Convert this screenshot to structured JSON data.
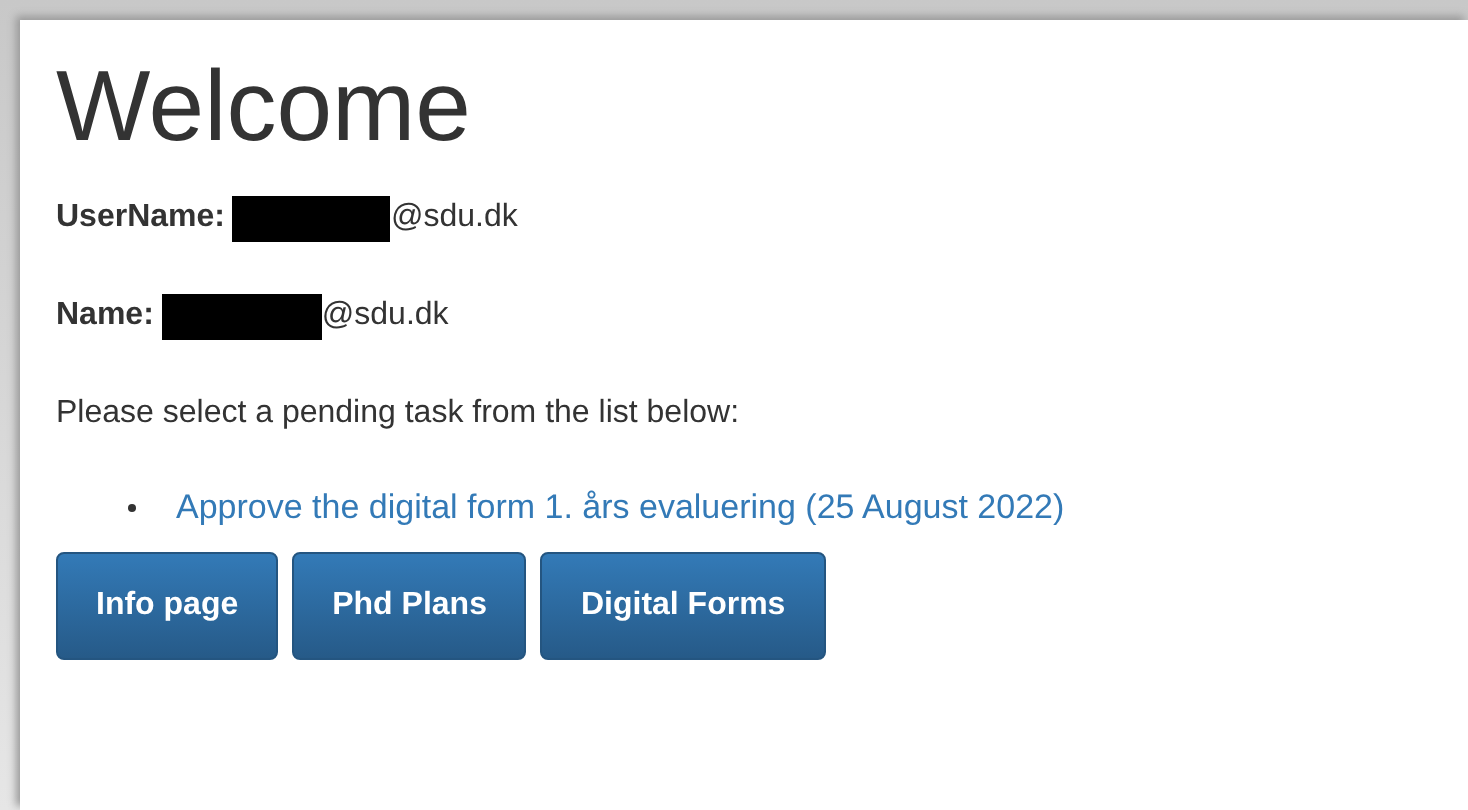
{
  "heading": "Welcome",
  "fields": [
    {
      "label": "UserName:",
      "value": "@sdu.dk"
    },
    {
      "label": "Name:",
      "value": "@sdu.dk"
    }
  ],
  "prompt": "Please select a pending task from the list below:",
  "tasks": [
    "Approve the digital form 1. års evaluering (25 August 2022)"
  ],
  "buttons": [
    "Info page",
    "Phd Plans",
    "Digital Forms"
  ]
}
